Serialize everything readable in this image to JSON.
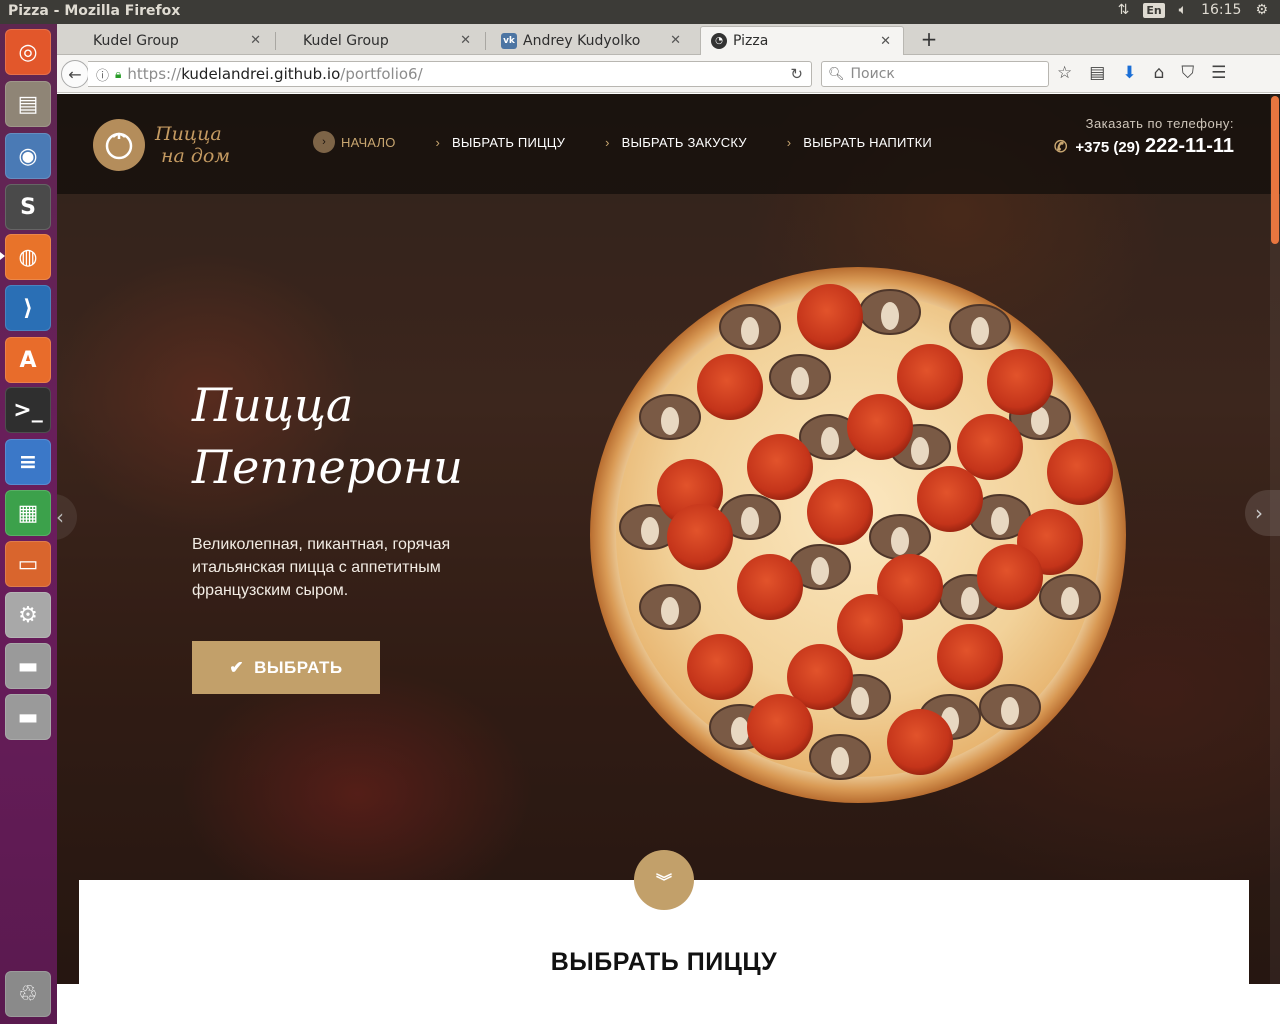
{
  "os": {
    "window_title": "Pizza - Mozilla Firefox",
    "tray": {
      "keyboard_layout": "En",
      "time": "16:15"
    },
    "launcher_apps": [
      {
        "name": "ubuntu-home",
        "glyph": "◎",
        "color": "#e2572b"
      },
      {
        "name": "files",
        "glyph": "▤",
        "color": "#8f8576"
      },
      {
        "name": "chromium",
        "glyph": "◉",
        "color": "#4a7ab5"
      },
      {
        "name": "sublime-text",
        "glyph": "S",
        "color": "#4a4a4a"
      },
      {
        "name": "firefox",
        "glyph": "◍",
        "color": "#e8732a"
      },
      {
        "name": "vscode",
        "glyph": "⟩",
        "color": "#2a6fb5"
      },
      {
        "name": "software-center",
        "glyph": "A",
        "color": "#e86c2b"
      },
      {
        "name": "terminal",
        "glyph": ">_",
        "color": "#2f2f2f"
      },
      {
        "name": "libreoffice-writer",
        "glyph": "≡",
        "color": "#3b78c8"
      },
      {
        "name": "libreoffice-calc",
        "glyph": "▦",
        "color": "#3ca14b"
      },
      {
        "name": "libreoffice-impress",
        "glyph": "▭",
        "color": "#d9652d"
      },
      {
        "name": "system-settings",
        "glyph": "⚙",
        "color": "#a8a8a8"
      },
      {
        "name": "drive-1",
        "glyph": "▬",
        "color": "#9a9a9a"
      },
      {
        "name": "drive-2",
        "glyph": "▬",
        "color": "#9a9a9a"
      },
      {
        "name": "trash",
        "glyph": "♲",
        "color": "#8a8a8a"
      }
    ]
  },
  "browser": {
    "tabs": [
      {
        "label": "Kudel Group",
        "active": false,
        "favicon": ""
      },
      {
        "label": "Kudel Group",
        "active": false,
        "favicon": ""
      },
      {
        "label": "Andrey Kudyolko",
        "active": false,
        "favicon": "vk"
      },
      {
        "label": "Pizza",
        "active": true,
        "favicon": "github"
      }
    ],
    "url": {
      "scheme": "https://",
      "host": "kudelandrei.github.io",
      "path": "/portfolio6/"
    },
    "search_placeholder": "Поиск"
  },
  "site": {
    "logo_line1": "Пицца",
    "logo_line2": "на дом",
    "nav": [
      {
        "label": "НАЧАЛО",
        "current": true
      },
      {
        "label": "ВЫБРАТЬ ПИЦЦУ",
        "current": false
      },
      {
        "label": "ВЫБРАТЬ ЗАКУСКУ",
        "current": false
      },
      {
        "label": "ВЫБРАТЬ НАПИТКИ",
        "current": false
      }
    ],
    "phone_caption": "Заказать по телефону:",
    "phone_code": "+375 (29)",
    "phone_number": "222-11-11",
    "hero": {
      "title_line1": "Пицца",
      "title_line2": "Пепперони",
      "description": "Великолепная, пикантная, горячая итальянская пицца с аппетитным французским сыром.",
      "button_label": "ВЫБРАТЬ"
    },
    "section_title": "ВЫБРАТЬ ПИЦЦУ"
  },
  "colors": {
    "accent": "#c2a06a",
    "header_bg": "#16100c",
    "launcher": "#5e2750",
    "scrollbar_thumb": "#e8763f"
  }
}
